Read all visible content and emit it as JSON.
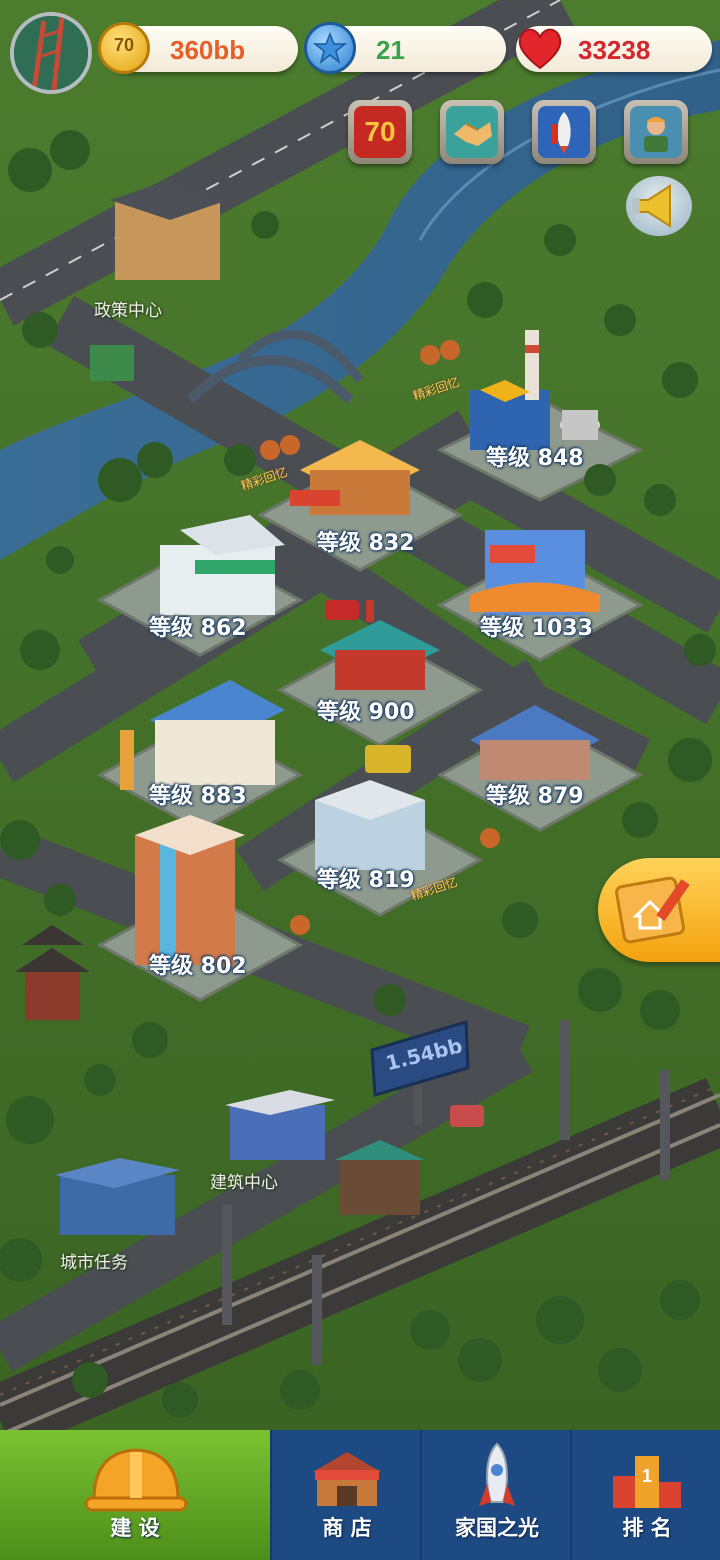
{
  "hud": {
    "coins": "360bb",
    "coin_badge": "70",
    "stars": "21",
    "hearts": "33238"
  },
  "tools": [
    {
      "name": "anniversary-70-icon",
      "text": "70"
    },
    {
      "name": "handshake-icon"
    },
    {
      "name": "rocket-icon"
    },
    {
      "name": "worker-icon"
    },
    {
      "name": "megaphone-icon"
    }
  ],
  "buildings": [
    {
      "name": "power-plant",
      "label": "等级 848"
    },
    {
      "name": "lumber-mill",
      "label": "等级 832"
    },
    {
      "name": "safety-factory",
      "label": "等级 862"
    },
    {
      "name": "department-store",
      "label": "等级 1033"
    },
    {
      "name": "pagoda-pavilion",
      "label": "等级 900"
    },
    {
      "name": "vegetable-market",
      "label": "等级 883"
    },
    {
      "name": "blue-roof-house",
      "label": "等级 879"
    },
    {
      "name": "office-block",
      "label": "等级 819"
    },
    {
      "name": "apartment-tower",
      "label": "等级 802"
    }
  ],
  "places": {
    "policy_center": "政策中心",
    "construction_center": "建筑中心",
    "city_tasks": "城市任务",
    "billboard": "1.54bb",
    "billboard_badges": [
      "精彩回忆",
      "精彩回忆",
      "精彩回忆"
    ]
  },
  "tabs": [
    {
      "id": "build",
      "label": "建 设",
      "active": true
    },
    {
      "id": "shop",
      "label": "商 店",
      "active": false
    },
    {
      "id": "glory",
      "label": "家国之光",
      "active": false
    },
    {
      "id": "rank",
      "label": "排 名",
      "active": false
    }
  ],
  "colors": {
    "coin": "#f0b21a",
    "star": "#4ea6ea",
    "heart": "#e2262b",
    "coin_text": "#e4602a",
    "star_text": "#3aa24a",
    "heart_text": "#d4262c",
    "tabbar": "#1e4a84",
    "tab_active": "#5fa51f"
  }
}
